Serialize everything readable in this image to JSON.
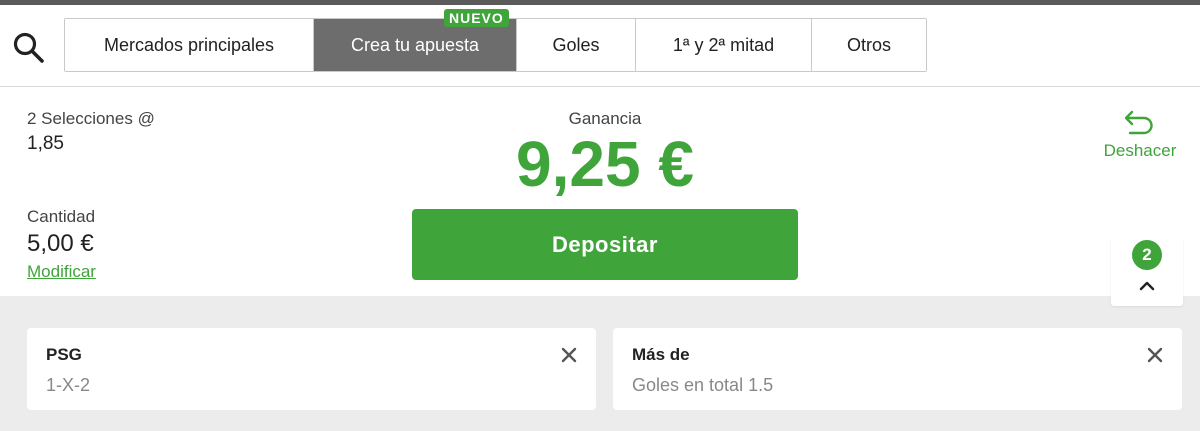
{
  "tabs": [
    {
      "label": "Mercados principales",
      "active": false
    },
    {
      "label": "Crea tu apuesta",
      "active": true,
      "badge": "NUEVO"
    },
    {
      "label": "Goles",
      "active": false
    },
    {
      "label": "1ª y 2ª mitad",
      "active": false
    },
    {
      "label": "Otros",
      "active": false
    }
  ],
  "summary": {
    "selections_label": "2 Selecciones @",
    "odds": "1,85",
    "gain_label": "Ganancia",
    "gain_value": "9,25 €",
    "amount_label": "Cantidad",
    "amount_value": "5,00 €",
    "modify_label": "Modificar",
    "deposit_label": "Depositar",
    "undo_label": "Deshacer"
  },
  "slip_toggle": {
    "count": "2"
  },
  "selections": [
    {
      "title": "PSG",
      "subtitle": "1-X-2"
    },
    {
      "title": "Más de",
      "subtitle": "Goles en total 1.5"
    }
  ],
  "icons": {
    "search": "search-icon",
    "undo": "undo-arrow-icon",
    "chevron": "chevron-up-icon",
    "close": "close-icon"
  },
  "colors": {
    "accent_green": "#3fa43a",
    "active_tab": "#6d6d6d",
    "gray_background": "#ececec"
  }
}
